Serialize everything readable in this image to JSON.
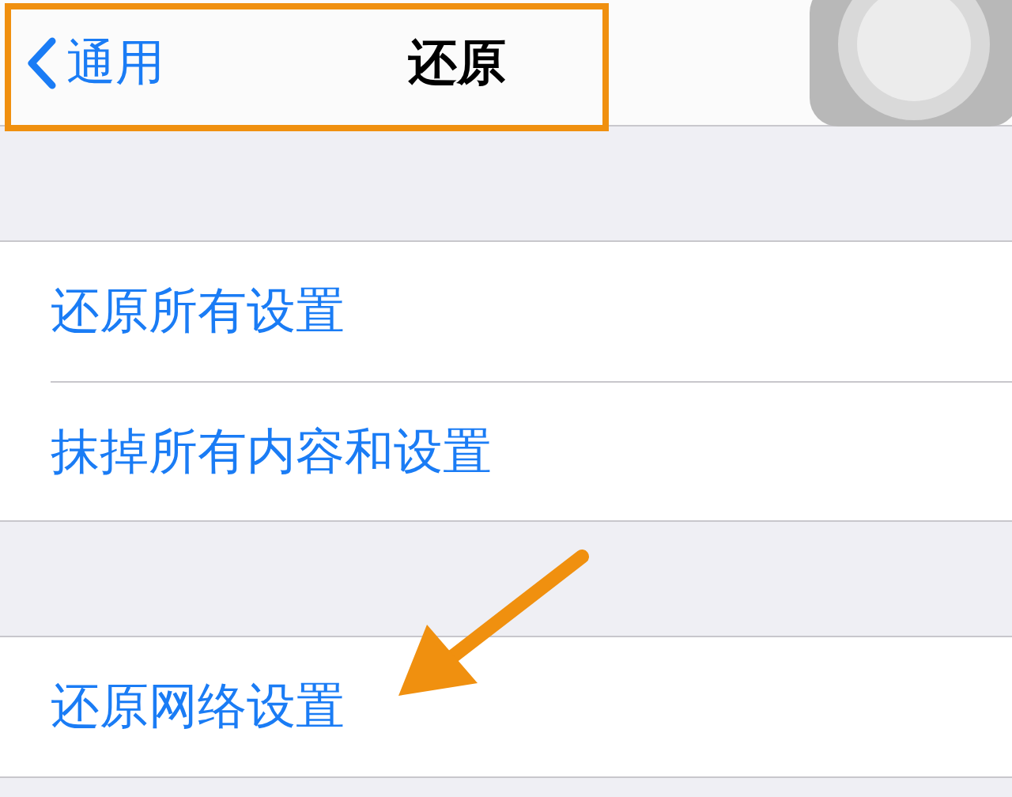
{
  "nav_bar": {
    "back_label": "通用",
    "title": "还原"
  },
  "groups": [
    {
      "items": [
        {
          "label": "还原所有设置"
        },
        {
          "label": "抹掉所有内容和设置"
        }
      ]
    },
    {
      "items": [
        {
          "label": "还原网络设置"
        }
      ]
    }
  ]
}
